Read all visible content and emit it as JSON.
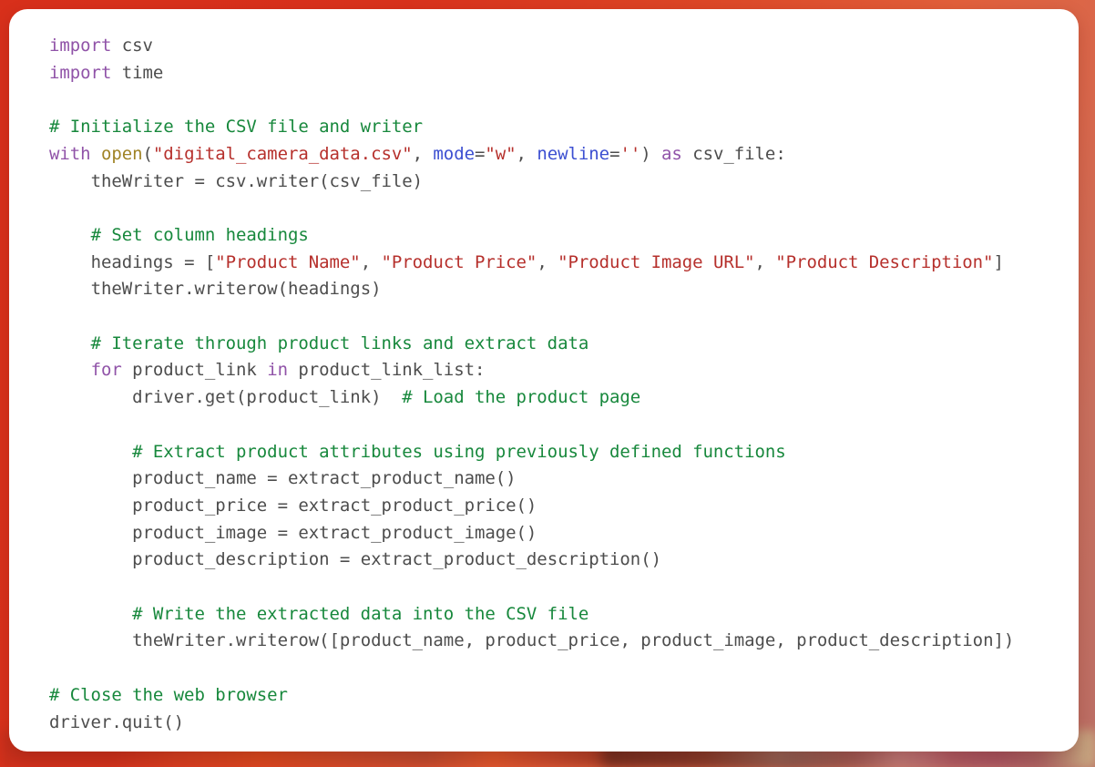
{
  "language": "python",
  "theme": {
    "card_background": "#ffffff",
    "page_background_start": "#d8301b",
    "page_background_end": "#bb6f66",
    "default_text": "#4d4d4d",
    "keyword": "#9053a8",
    "comment": "#17883c",
    "string": "#b6302c",
    "function": "#a08325",
    "kwarg": "#3c4fd1"
  },
  "code": {
    "line_count": 25,
    "lines": [
      {
        "n": 1,
        "text": "import csv"
      },
      {
        "n": 2,
        "text": "import time"
      },
      {
        "n": 3,
        "text": ""
      },
      {
        "n": 4,
        "text": "# Initialize the CSV file and writer"
      },
      {
        "n": 5,
        "text": "with open(\"digital_camera_data.csv\", mode=\"w\", newline='') as csv_file:"
      },
      {
        "n": 6,
        "text": "    theWriter = csv.writer(csv_file)"
      },
      {
        "n": 7,
        "text": ""
      },
      {
        "n": 8,
        "text": "    # Set column headings"
      },
      {
        "n": 9,
        "text": "    headings = [\"Product Name\", \"Product Price\", \"Product Image URL\", \"Product Description\"]"
      },
      {
        "n": 10,
        "text": "    theWriter.writerow(headings)"
      },
      {
        "n": 11,
        "text": ""
      },
      {
        "n": 12,
        "text": "    # Iterate through product links and extract data"
      },
      {
        "n": 13,
        "text": "    for product_link in product_link_list:"
      },
      {
        "n": 14,
        "text": "        driver.get(product_link)  # Load the product page"
      },
      {
        "n": 15,
        "text": ""
      },
      {
        "n": 16,
        "text": "        # Extract product attributes using previously defined functions"
      },
      {
        "n": 17,
        "text": "        product_name = extract_product_name()"
      },
      {
        "n": 18,
        "text": "        product_price = extract_product_price()"
      },
      {
        "n": 19,
        "text": "        product_image = extract_product_image()"
      },
      {
        "n": 20,
        "text": "        product_description = extract_product_description()"
      },
      {
        "n": 21,
        "text": ""
      },
      {
        "n": 22,
        "text": "        # Write the extracted data into the CSV file"
      },
      {
        "n": 23,
        "text": "        theWriter.writerow([product_name, product_price, product_image, product_description])"
      },
      {
        "n": 24,
        "text": ""
      },
      {
        "n": 25,
        "text": "# Close the web browser"
      },
      {
        "n": 26,
        "text": "driver.quit()"
      }
    ],
    "tokens": {
      "keywords": [
        "import",
        "with",
        "as",
        "for",
        "in"
      ],
      "builtins": [
        "open"
      ],
      "kwargs": [
        "mode",
        "newline"
      ],
      "strings": [
        "\"digital_camera_data.csv\"",
        "\"w\"",
        "''",
        "\"Product Name\"",
        "\"Product Price\"",
        "\"Product Image URL\"",
        "\"Product Description\""
      ],
      "comments": [
        "# Initialize the CSV file and writer",
        "# Set column headings",
        "# Iterate through product links and extract data",
        "# Load the product page",
        "# Extract product attributes using previously defined functions",
        "# Write the extracted data into the CSV file",
        "# Close the web browser"
      ],
      "identifiers": [
        "csv",
        "time",
        "csv_file",
        "theWriter",
        "csv.writer",
        "headings",
        "theWriter.writerow",
        "product_link",
        "product_link_list",
        "driver.get",
        "product_name",
        "extract_product_name",
        "product_price",
        "extract_product_price",
        "product_image",
        "extract_product_image",
        "product_description",
        "extract_product_description",
        "driver.quit"
      ]
    }
  }
}
